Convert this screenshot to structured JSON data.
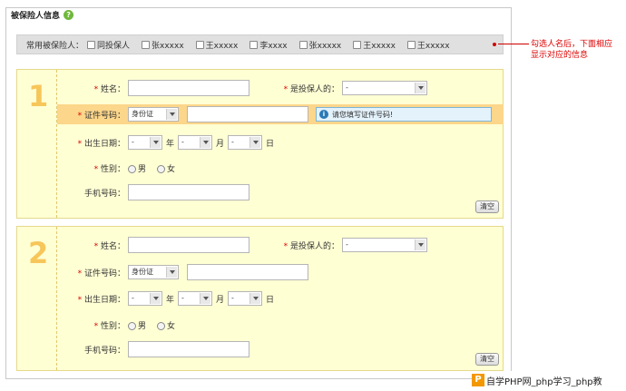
{
  "section": {
    "title": "被保险人信息",
    "help_icon": "question-icon"
  },
  "contacts": {
    "label": "常用被保险人：",
    "options": [
      "同投保人",
      "张xxxxx",
      "王xxxxx",
      "李xxxx",
      "张xxxxx",
      "王xxxxx",
      "王xxxxx"
    ]
  },
  "annotation": {
    "line1": "勾选人名后，下面相应",
    "line2": "显示对应的信息"
  },
  "forms": [
    {
      "number": "1",
      "name_label": "姓名：",
      "relation_label": "是投保人的：",
      "relation_value": "-",
      "id_label": "证件号码：",
      "id_type": "身份证",
      "id_tip": "请您填写证件号码!",
      "birth_label": "出生日期：",
      "year_value": "-",
      "year_unit": "年",
      "month_value": "-",
      "month_unit": "月",
      "day_value": "-",
      "day_unit": "日",
      "gender_label": "性别：",
      "male": "男",
      "female": "女",
      "phone_label": "手机号码：",
      "clear_label": "清空"
    },
    {
      "number": "2",
      "name_label": "姓名：",
      "relation_label": "是投保人的：",
      "relation_value": "-",
      "id_label": "证件号码：",
      "id_type": "身份证",
      "birth_label": "出生日期：",
      "year_value": "-",
      "year_unit": "年",
      "month_value": "-",
      "month_unit": "月",
      "day_value": "-",
      "day_unit": "日",
      "gender_label": "性别：",
      "male": "男",
      "female": "女",
      "phone_label": "手机号码：",
      "clear_label": "清空"
    }
  ],
  "watermark": {
    "logo": "P",
    "text": "自学PHP网_php学习_php教"
  },
  "colors": {
    "block_bg": "#ffffd4",
    "number": "#f7c65a",
    "highlight": "#fcd68a",
    "required": "#dd0000",
    "annotation": "#dd0000"
  }
}
